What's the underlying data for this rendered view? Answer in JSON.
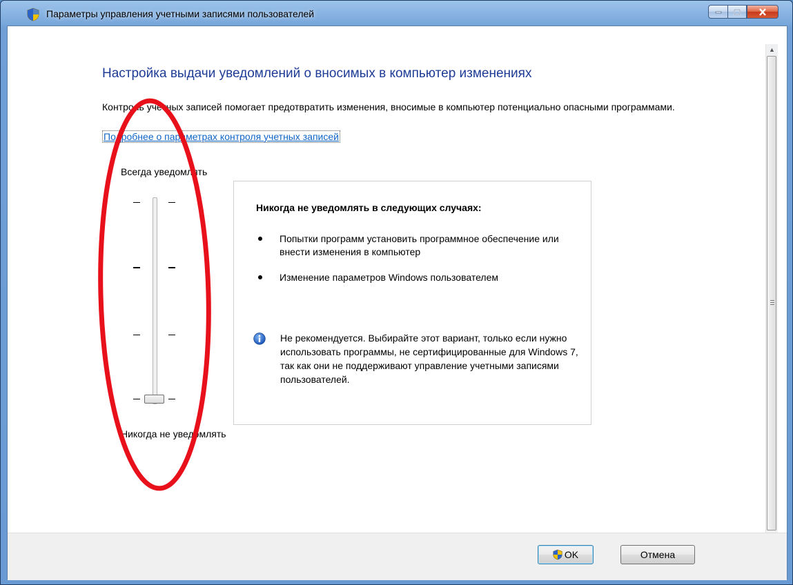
{
  "window": {
    "title": "Параметры управления учетными записями пользователей"
  },
  "main": {
    "heading": "Настройка выдачи уведомлений о вносимых в компьютер изменениях",
    "description": "Контроль учетных записей помогает предотвратить изменения, вносимые в компьютер потенциально опасными программами.",
    "link": "Подробнее о параметрах контроля учетных записей"
  },
  "slider": {
    "top_label": "Всегда уведомлять",
    "bottom_label": "Никогда не уведомлять",
    "levels": 4,
    "selected_level": 1
  },
  "panel": {
    "title": "Никогда не уведомлять в следующих случаях:",
    "bullets": [
      "Попытки программ установить программное обеспечение или внести изменения в компьютер",
      "Изменение параметров Windows пользователем"
    ],
    "info": "Не рекомендуется. Выбирайте этот вариант, только если нужно использовать программы, не сертифицированные для Windows 7, так как они не поддерживают управление учетными записями пользователей."
  },
  "buttons": {
    "ok": "OK",
    "cancel": "Отмена"
  },
  "icons": {
    "title": "uac-shield-icon",
    "info": "info-icon",
    "ok": "uac-shield-icon"
  },
  "colors": {
    "heading": "#1e3c96",
    "link": "#0f65c7",
    "annotation": "#e8101a"
  }
}
